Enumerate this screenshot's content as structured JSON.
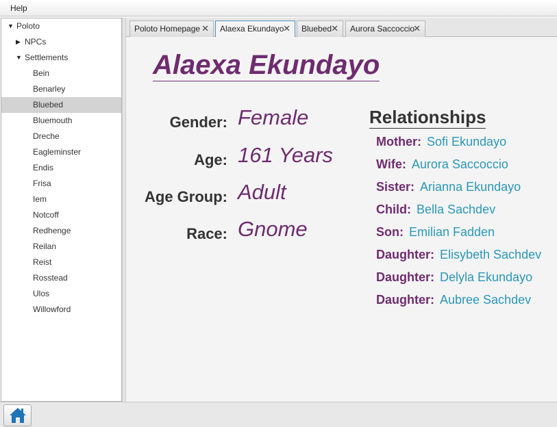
{
  "menu": {
    "help": "Help"
  },
  "tree": {
    "root": "Poloto",
    "npcs": "NPCs",
    "settlements": "Settlements",
    "settlement_items": [
      "Bein",
      "Benarley",
      "Bluebed",
      "Bluemouth",
      "Dreche",
      "Eagleminster",
      "Endis",
      "Frisa",
      "Iem",
      "Notcoff",
      "Redhenge",
      "Reilan",
      "Reist",
      "Rosstead",
      "Ulos",
      "Willowford"
    ],
    "selected": "Bluebed"
  },
  "tabs": [
    {
      "label": "Poloto Homepage",
      "active": false
    },
    {
      "label": "Alaexa Ekundayo",
      "active": true
    },
    {
      "label": "Bluebed",
      "active": false
    },
    {
      "label": "Aurora Saccoccio",
      "active": false
    }
  ],
  "npc": {
    "name": "Alaexa Ekundayo",
    "fields": [
      {
        "label": "Gender:",
        "value": "Female"
      },
      {
        "label": "Age:",
        "value": "161 Years"
      },
      {
        "label": "Age Group:",
        "value": "Adult"
      },
      {
        "label": "Race:",
        "value": "Gnome"
      }
    ]
  },
  "relationships": {
    "heading": "Relationships",
    "items": [
      {
        "type": "Mother:",
        "name": "Sofi Ekundayo"
      },
      {
        "type": "Wife:",
        "name": "Aurora Saccoccio"
      },
      {
        "type": "Sister:",
        "name": "Arianna Ekundayo"
      },
      {
        "type": "Child:",
        "name": "Bella Sachdev"
      },
      {
        "type": "Son:",
        "name": "Emilian Fadden"
      },
      {
        "type": "Daughter:",
        "name": "Elisybeth Sachdev"
      },
      {
        "type": "Daughter:",
        "name": "Delyla Ekundayo"
      },
      {
        "type": "Daughter:",
        "name": "Aubree Sachdev"
      }
    ]
  },
  "colors": {
    "accent_purple": "#6e2c6f",
    "link_teal": "#2a97b8",
    "selection": "#d3d3d3"
  },
  "icons": {
    "home": "home-icon",
    "tree_expanded": "triangle-down-icon",
    "tree_collapsed": "triangle-right-icon",
    "tab_close": "close-icon"
  }
}
